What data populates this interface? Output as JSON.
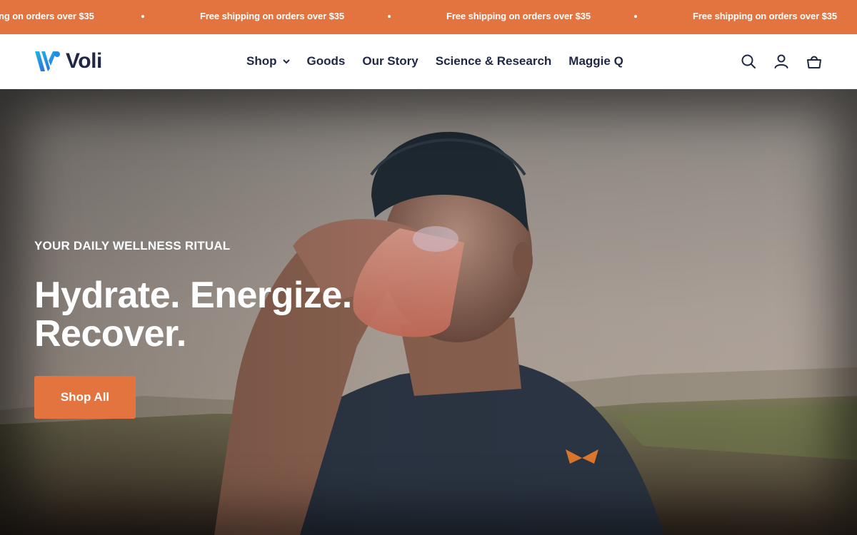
{
  "announcement": {
    "messages": [
      "ng on orders over $35",
      "Free shipping on orders over $35",
      "Free shipping on orders over $35",
      "Free shipping on orders over $35"
    ],
    "background": "#e4743f"
  },
  "header": {
    "logo_text": "Voli",
    "nav": [
      {
        "label": "Shop",
        "has_dropdown": true
      },
      {
        "label": "Goods"
      },
      {
        "label": "Our Story"
      },
      {
        "label": "Science & Research"
      },
      {
        "label": "Maggie Q"
      }
    ],
    "icons": [
      "search-icon",
      "account-icon",
      "cart-icon"
    ]
  },
  "hero": {
    "eyebrow": "YOUR DAILY WELLNESS RITUAL",
    "headline_line1": "Hydrate. Energize.",
    "headline_line2": "Recover.",
    "cta_label": "Shop All",
    "accent": "#e4743f"
  },
  "colors": {
    "brand_navy": "#1f2744",
    "brand_blue": "#2a8fe0"
  }
}
